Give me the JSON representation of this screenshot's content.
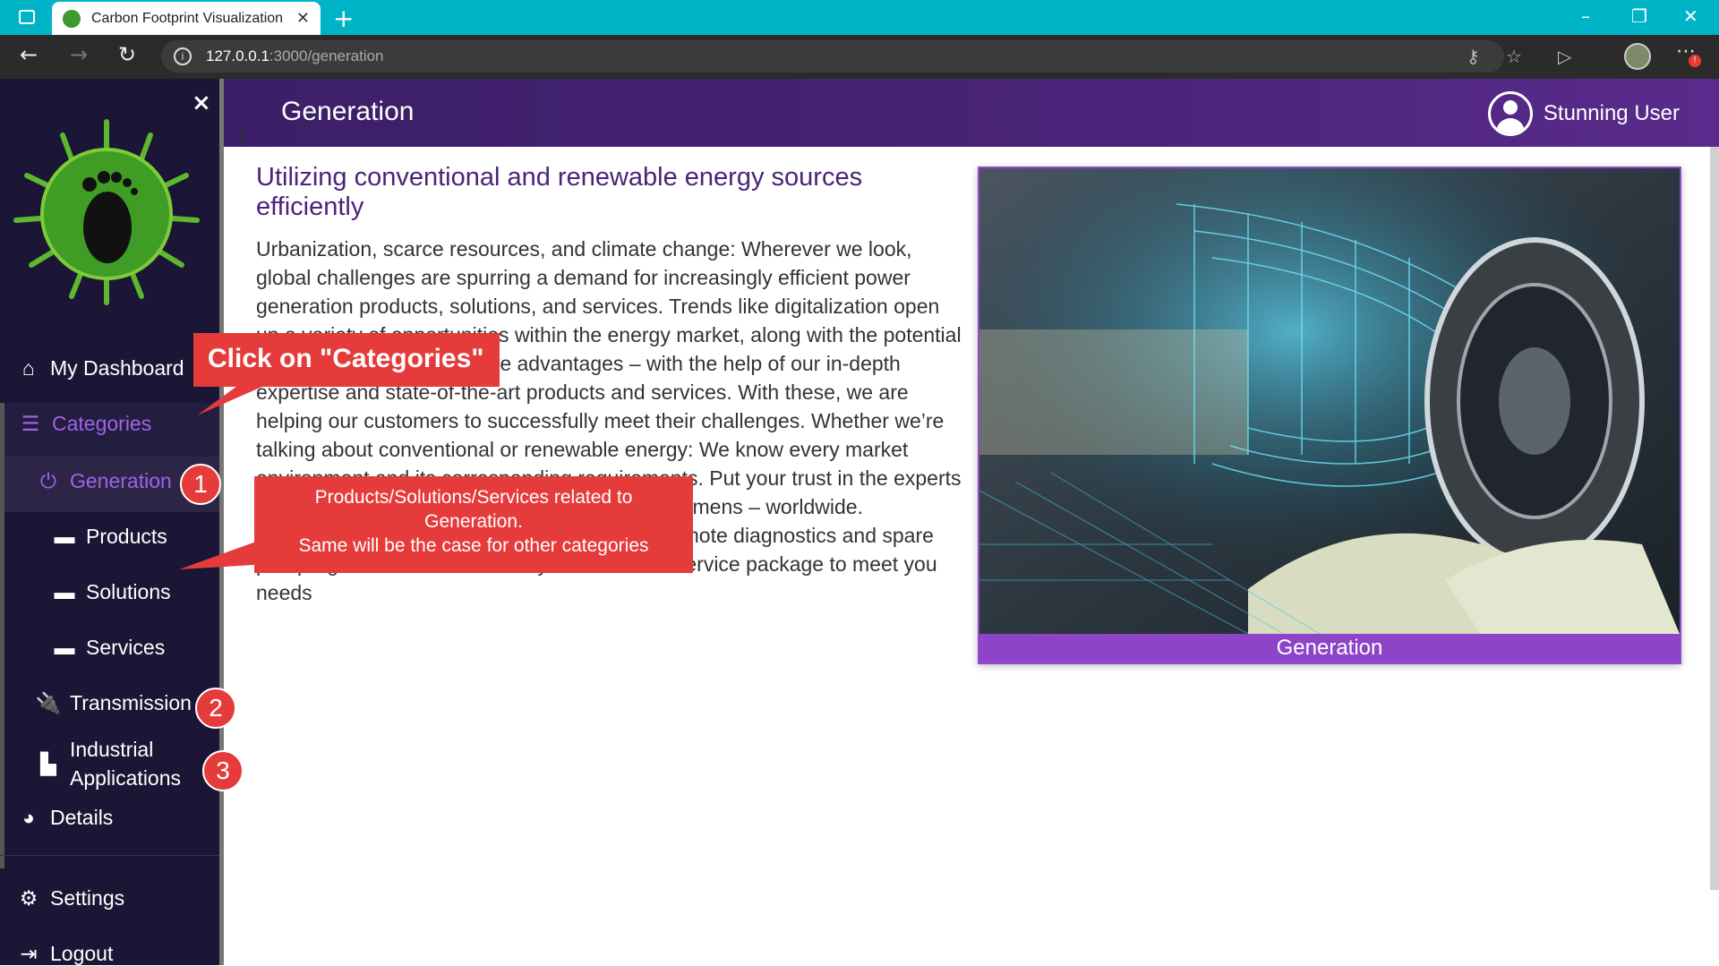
{
  "browser": {
    "tab_title": "Carbon Footprint Visualization",
    "tab_close": "✕",
    "new_tab": "+",
    "url_host": "127.0.0.1",
    "url_path": ":3000/generation"
  },
  "sidebar": {
    "close": "×",
    "items": [
      {
        "label": "My Dashboard",
        "icon": "home-icon"
      },
      {
        "label": "Categories",
        "icon": "list-icon"
      },
      {
        "label": "Generation",
        "icon": "power-icon"
      },
      {
        "label": "Products",
        "icon": "dash-icon"
      },
      {
        "label": "Solutions",
        "icon": "dash-icon"
      },
      {
        "label": "Services",
        "icon": "dash-icon"
      },
      {
        "label": "Transmission",
        "icon": "plug-icon"
      },
      {
        "label": "Industrial Applications",
        "icon": "factory-icon"
      },
      {
        "label": "Details",
        "icon": "pie-chart-icon"
      },
      {
        "label": "Settings",
        "icon": "gears-icon"
      },
      {
        "label": "Logout",
        "icon": "sign-out-icon"
      }
    ]
  },
  "header": {
    "title": "Generation",
    "user_name": "Stunning User"
  },
  "main": {
    "heading": "Utilizing conventional and renewable energy sources efficiently",
    "paragraph": "Urbanization, scarce resources, and climate change: Wherever we look, global challenges are spurring a demand for increasingly efficient power generation products, solutions, and services. Trends like digitalization open up a variety of opportunities within the energy market, along with the potential of change. Gain competitive advantages – with the help of our in-depth expertise and state-of-the-art products and services. With these, we are helping our customers to successfully meet their challenges. Whether we’re talking about conventional or renewable energy: We know every market environment and its corresponding requirements. Put your trust in the experts from Carbon Footprint Visualization Team of Siemens – worldwide. Modernization, upgrades, and maintenance, remote diagnostics and spare part programs – we customize your individual service package to meet you needs",
    "image_caption": "Generation"
  },
  "annotations": {
    "callout_categories": "Click on \"Categories\"",
    "callout_products": "Products/Solutions/Services related to Generation.\nSame will be the case for other categories",
    "badge_1": "1",
    "badge_2": "2",
    "badge_3": "3"
  },
  "colors": {
    "brand_purple": "#4a2479",
    "accent_violet": "#a062e8",
    "callout_red": "#e53b3b",
    "sidebar_bg": "#1c1636"
  }
}
